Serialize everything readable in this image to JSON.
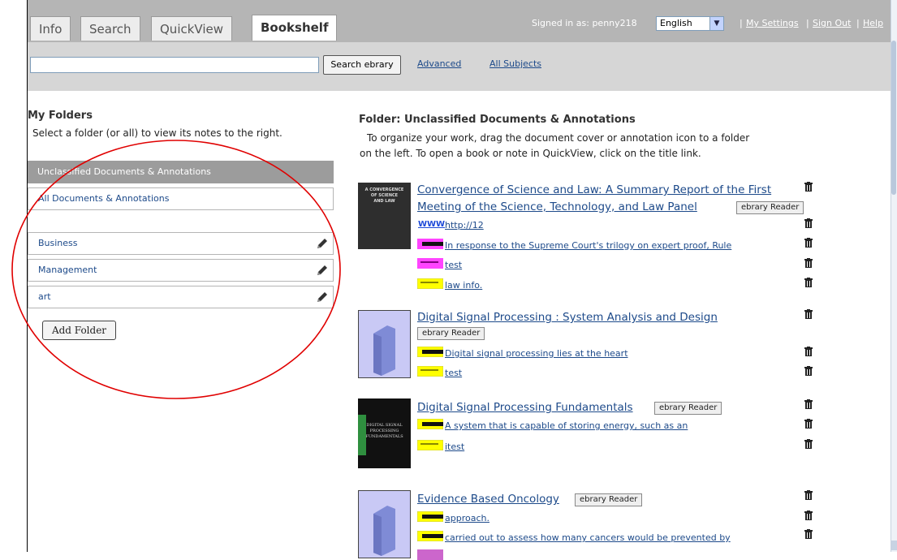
{
  "tabs": [
    "Info",
    "Search",
    "QuickView",
    "Bookshelf"
  ],
  "active_tab": "Bookshelf",
  "header": {
    "signed_in": "Signed in as: penny218",
    "language": "English",
    "my_settings": "My Settings",
    "sign_out": "Sign Out",
    "help": "Help",
    "separator": "|"
  },
  "search": {
    "value": "",
    "button_label": "Search ebrary",
    "advanced": "Advanced",
    "all_subjects": "All Subjects"
  },
  "folders": {
    "heading": "My Folders",
    "description": "Select a folder (or all) to view its notes to the right.",
    "selected": "Unclassified Documents & Annotations",
    "all": "All Documents & Annotations",
    "user_folders": [
      "Business",
      "Management",
      "art"
    ],
    "add_button": "Add Folder"
  },
  "main": {
    "heading": "Folder: Unclassified Documents & Annotations",
    "instructions_line1": "To organize your work, drag the document cover or annotation icon to a folder",
    "instructions_line2": "on the left. To open a book or note in QuickView, click on the title link.",
    "reader_label": "ebrary Reader",
    "documents": [
      {
        "title_line1": "Convergence of Science and Law: A Summary Report of the First",
        "title_line2": "Meeting of the Science, Technology, and Law Panel",
        "cover_line1": "A CONVERGENCE",
        "cover_line2": "OF SCIENCE",
        "cover_line3": "AND LAW",
        "annotations": [
          {
            "type": "www",
            "label": "WWW",
            "text": "http://12"
          },
          {
            "type": "note-magenta",
            "text": "In response to the Supreme Court's trilogy on expert proof, Rule"
          },
          {
            "type": "highlight-magenta",
            "text": "test"
          },
          {
            "type": "highlight-yellow",
            "text": "law info."
          }
        ]
      },
      {
        "title_line1": "Digital Signal Processing : System Analysis and Design",
        "annotations": [
          {
            "type": "note-yellow",
            "text": "Digital signal processing lies at the heart"
          },
          {
            "type": "highlight-yellow",
            "text": "test"
          }
        ]
      },
      {
        "title_line1": "Digital Signal Processing Fundamentals",
        "cover_line1": "DIGITAL SIGNAL",
        "cover_line2": "PROCESSING",
        "cover_line3": "FUNDAMENTALS",
        "annotations": [
          {
            "type": "note-yellow",
            "text": "A system that is capable of storing energy, such as an"
          },
          {
            "type": "highlight-yellow",
            "text": "itest"
          }
        ]
      },
      {
        "title_line1": "Evidence Based Oncology",
        "annotations": [
          {
            "type": "note-yellow",
            "text": "approach."
          },
          {
            "type": "note-yellow",
            "text": "carried out to assess how many cancers would be prevented by"
          }
        ]
      }
    ]
  },
  "colors": {
    "link": "#1d4a8a",
    "topbar": "#b5b5b5",
    "searchbar": "#d6d6d6",
    "selected_folder": "#9c9c9c",
    "highlight_yellow": "#ffff00",
    "highlight_magenta": "#ff44ff",
    "annotation_circle": "#e00000"
  }
}
